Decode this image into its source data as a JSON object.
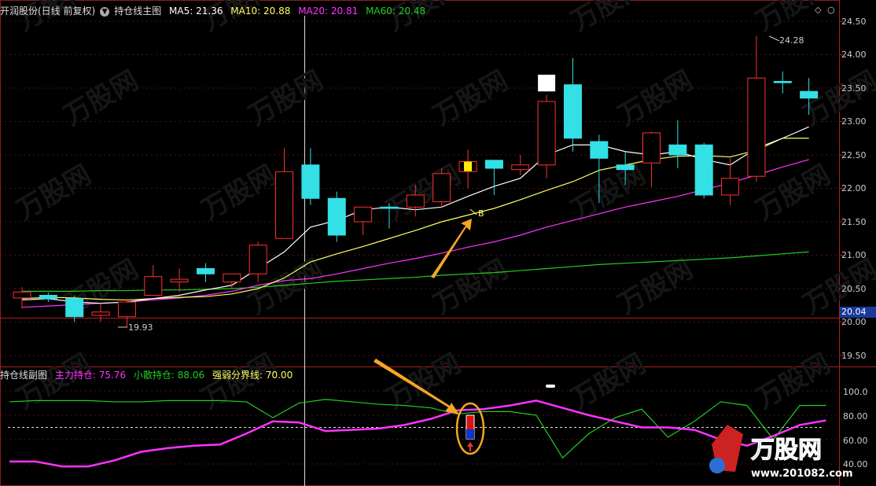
{
  "main_header": {
    "ticker": "开润股份(日线 前复权)",
    "indicator": "持仓线主图",
    "ma5_label": "MA5:",
    "ma5_value": "21.36",
    "ma10_label": "MA10:",
    "ma10_value": "20.88",
    "ma20_label": "MA20:",
    "ma20_value": "20.81",
    "ma60_label": "MA60:",
    "ma60_value": "20.48"
  },
  "sub_header": {
    "indicator": "持仓线副图",
    "main_pos_label": "主力持仓:",
    "main_pos_value": "75.76",
    "retail_label": "小散持仓:",
    "retail_value": "88.06",
    "threshold_label": "强弱分界线:",
    "threshold_value": "70.00"
  },
  "window_controls": {
    "diamond": "◇",
    "circle": "○"
  },
  "price_axis": [
    "24.50",
    "24.00",
    "23.50",
    "23.00",
    "22.50",
    "22.00",
    "21.50",
    "21.00",
    "20.50",
    "20.00",
    "19.50"
  ],
  "sub_axis": [
    "100.0",
    "80.00",
    "60.00",
    "40.00"
  ],
  "current_price": "20.04",
  "annotations": {
    "high": "24.28",
    "low": "19.93",
    "buy": "B"
  },
  "watermark": {
    "brand": "万股网",
    "url": "www.201082.com"
  },
  "colors": {
    "up": "#ff3030",
    "down": "#33e0e6",
    "ma5": "#ffffff",
    "ma10": "#ffff66",
    "ma20": "#ff33ff",
    "ma60": "#22cc22",
    "arrow": "#f5a623"
  },
  "chart_data": [
    {
      "type": "candlestick",
      "title": "持仓线主图",
      "ylim": [
        19.3,
        24.7
      ],
      "candles": [
        {
          "o": 20.36,
          "h": 20.52,
          "l": 20.2,
          "c": 20.45
        },
        {
          "o": 20.4,
          "h": 20.44,
          "l": 20.3,
          "c": 20.35
        },
        {
          "o": 20.35,
          "h": 20.4,
          "l": 20.0,
          "c": 20.08
        },
        {
          "o": 20.1,
          "h": 20.28,
          "l": 20.0,
          "c": 20.15
        },
        {
          "o": 20.08,
          "h": 20.35,
          "l": 19.93,
          "c": 20.3
        },
        {
          "o": 20.4,
          "h": 20.85,
          "l": 20.4,
          "c": 20.68
        },
        {
          "o": 20.6,
          "h": 20.8,
          "l": 20.45,
          "c": 20.64
        },
        {
          "o": 20.8,
          "h": 20.88,
          "l": 20.6,
          "c": 20.72
        },
        {
          "o": 20.6,
          "h": 20.72,
          "l": 20.5,
          "c": 20.72
        },
        {
          "o": 20.72,
          "h": 21.2,
          "l": 20.6,
          "c": 21.15
        },
        {
          "o": 21.25,
          "h": 22.6,
          "l": 21.25,
          "c": 22.25
        },
        {
          "o": 22.35,
          "h": 22.6,
          "l": 21.75,
          "c": 21.85
        },
        {
          "o": 21.85,
          "h": 21.95,
          "l": 21.2,
          "c": 21.3
        },
        {
          "o": 21.5,
          "h": 21.72,
          "l": 21.3,
          "c": 21.72
        },
        {
          "o": 21.72,
          "h": 21.78,
          "l": 21.4,
          "c": 21.7
        },
        {
          "o": 21.72,
          "h": 22.05,
          "l": 21.58,
          "c": 21.9
        },
        {
          "o": 21.8,
          "h": 22.3,
          "l": 21.7,
          "c": 22.22
        },
        {
          "o": 22.25,
          "h": 22.58,
          "l": 22.0,
          "c": 22.4
        },
        {
          "o": 22.42,
          "h": 22.42,
          "l": 21.9,
          "c": 22.3
        },
        {
          "o": 22.28,
          "h": 22.5,
          "l": 22.2,
          "c": 22.35
        },
        {
          "o": 22.35,
          "h": 23.4,
          "l": 22.15,
          "c": 23.3
        },
        {
          "o": 23.55,
          "h": 23.95,
          "l": 22.55,
          "c": 22.75
        },
        {
          "o": 22.7,
          "h": 22.8,
          "l": 21.78,
          "c": 22.45
        },
        {
          "o": 22.35,
          "h": 22.55,
          "l": 22.05,
          "c": 22.28
        },
        {
          "o": 22.38,
          "h": 22.85,
          "l": 22.02,
          "c": 22.83
        },
        {
          "o": 22.65,
          "h": 23.02,
          "l": 22.3,
          "c": 22.5
        },
        {
          "o": 22.65,
          "h": 22.68,
          "l": 21.85,
          "c": 21.9
        },
        {
          "o": 21.9,
          "h": 22.45,
          "l": 21.75,
          "c": 22.15
        },
        {
          "o": 22.18,
          "h": 24.28,
          "l": 22.1,
          "c": 23.65
        },
        {
          "o": 23.6,
          "h": 23.75,
          "l": 23.42,
          "c": 23.58
        },
        {
          "o": 23.45,
          "h": 23.65,
          "l": 23.1,
          "c": 23.35
        }
      ],
      "ma5": [
        20.33,
        20.35,
        20.3,
        20.28,
        20.3,
        20.35,
        20.4,
        20.48,
        20.55,
        20.8,
        21.05,
        21.42,
        21.52,
        21.68,
        21.72,
        21.68,
        21.72,
        21.88,
        22.03,
        22.15,
        22.5,
        22.65,
        22.65,
        22.55,
        22.5,
        22.55,
        22.43,
        22.35,
        22.6,
        22.75,
        22.92
      ],
      "ma10": [
        20.35,
        20.37,
        20.36,
        20.34,
        20.33,
        20.35,
        20.37,
        20.38,
        20.42,
        20.5,
        20.66,
        20.9,
        21.02,
        21.13,
        21.25,
        21.37,
        21.5,
        21.6,
        21.7,
        21.83,
        21.97,
        22.1,
        22.27,
        22.35,
        22.43,
        22.48,
        22.49,
        22.47,
        22.57,
        22.75,
        22.75
      ],
      "ma20": [
        20.22,
        20.24,
        20.26,
        20.28,
        20.3,
        20.33,
        20.36,
        20.4,
        20.46,
        20.55,
        20.62,
        20.65,
        20.72,
        20.8,
        20.88,
        20.95,
        21.03,
        21.12,
        21.2,
        21.3,
        21.42,
        21.52,
        21.62,
        21.72,
        21.8,
        21.88,
        21.98,
        22.08,
        22.2,
        22.32,
        22.43
      ],
      "ma60": [
        20.46,
        20.46,
        20.46,
        20.47,
        20.47,
        20.48,
        20.48,
        20.49,
        20.5,
        20.52,
        20.55,
        20.58,
        20.61,
        20.63,
        20.65,
        20.67,
        20.7,
        20.72,
        20.74,
        20.77,
        20.8,
        20.83,
        20.86,
        20.88,
        20.9,
        20.92,
        20.94,
        20.96,
        20.99,
        21.02,
        21.05
      ]
    },
    {
      "type": "line",
      "title": "持仓线副图",
      "ylim": [
        35,
        108
      ],
      "series": [
        {
          "name": "主力持仓",
          "values": [
            42,
            42,
            38,
            38,
            43,
            50,
            53,
            55,
            56,
            65,
            75,
            74,
            67,
            68,
            69,
            72,
            77,
            84,
            85,
            88,
            92,
            86,
            80,
            75,
            70,
            70,
            68,
            60,
            55,
            63,
            72,
            75.76
          ]
        },
        {
          "name": "小散持仓",
          "values": [
            91,
            92,
            92,
            92,
            91,
            91,
            92,
            92,
            92,
            91,
            78,
            90,
            93,
            91,
            89,
            88,
            86,
            81,
            83,
            83,
            80,
            45,
            65,
            78,
            85,
            62,
            75,
            91,
            88,
            60,
            88,
            88.06
          ]
        },
        {
          "name": "强弱分界线",
          "values": [
            70,
            70
          ]
        }
      ]
    }
  ]
}
